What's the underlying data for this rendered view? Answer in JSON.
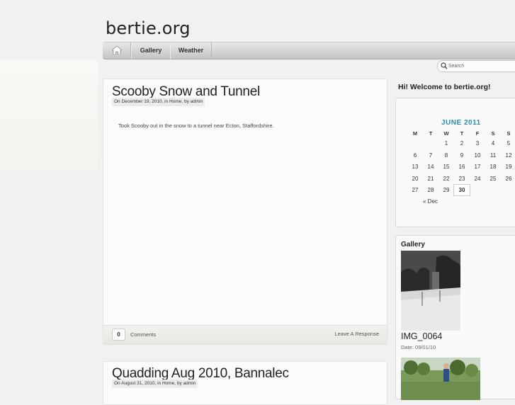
{
  "site": {
    "title": "bertie.org"
  },
  "nav": {
    "home_icon": "home-icon",
    "items": [
      {
        "label": "Gallery"
      },
      {
        "label": "Weather"
      }
    ]
  },
  "search": {
    "placeholder": "Search"
  },
  "posts": [
    {
      "title": "Scooby Snow and Tunnel",
      "meta": "On December 19, 2010, in Home, by admin",
      "excerpt": "Took Scooby out in the snow to a tunnel near Ecton, Staffordshire.",
      "comment_count": "0",
      "comments_label": "Comments",
      "leave_response": "Leave A Response"
    },
    {
      "title": "Quadding Aug 2010, Bannalec",
      "meta": "On August 31, 2010, in Home, by admin"
    }
  ],
  "sidebar": {
    "welcome": "Hi! Welcome to bertie.org!",
    "calendar": {
      "caption": "JUNE 2011",
      "weekdays": [
        "M",
        "T",
        "W",
        "T",
        "F",
        "S",
        "S"
      ],
      "weeks": [
        [
          "",
          "",
          "1",
          "2",
          "3",
          "4",
          "5"
        ],
        [
          "6",
          "7",
          "8",
          "9",
          "10",
          "11",
          "12"
        ],
        [
          "13",
          "14",
          "15",
          "16",
          "17",
          "18",
          "19"
        ],
        [
          "20",
          "21",
          "22",
          "23",
          "24",
          "25",
          "26"
        ],
        [
          "27",
          "28",
          "29",
          "30",
          "",
          "",
          ""
        ]
      ],
      "today": "30",
      "prev_link": "« Dec"
    },
    "gallery": {
      "title": "Gallery",
      "image_title": "IMG_0064",
      "image_date": "Date: 09/01/10"
    }
  }
}
